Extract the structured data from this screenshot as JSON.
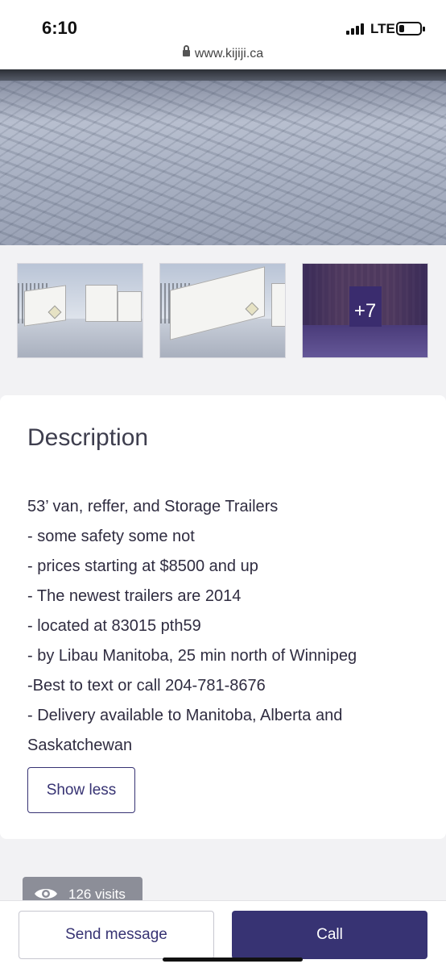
{
  "status_bar": {
    "time": "6:10",
    "network": "LTE",
    "url": "www.kijiji.ca",
    "battery_level": 0.2,
    "signal_bars": 4
  },
  "gallery": {
    "more_count": "+7",
    "thumbnails": [
      "trailers-row",
      "trailer-side",
      "trailer-interior"
    ]
  },
  "description": {
    "title": "Description",
    "lines": [
      "53’ van, reffer, and Storage Trailers",
      "- some safety some not",
      "- prices starting at $8500 and up",
      "- The newest trailers are 2014",
      "- located at 83015 pth59",
      "- by Libau Manitoba, 25 min north of Winnipeg",
      "-Best to text or call 204-781-8676",
      "- Delivery available to Manitoba, Alberta and",
      "Saskatchewan"
    ],
    "show_less_label": "Show less"
  },
  "visits": {
    "label": "126 visits",
    "icon": "eye-icon"
  },
  "actions": {
    "send_message_label": "Send message",
    "call_label": "Call"
  },
  "colors": {
    "brand": "#373373",
    "page_bg": "#f2f2f4",
    "visits_badge": "#8c8e98"
  }
}
